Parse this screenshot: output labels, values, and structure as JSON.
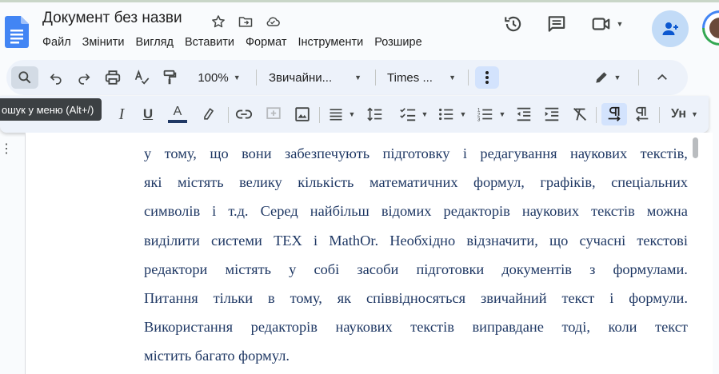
{
  "app": {
    "title": "Документ без назви"
  },
  "menu": [
    "Файл",
    "Змінити",
    "Вигляд",
    "Вставити",
    "Формат",
    "Інструменти",
    "Розшире"
  ],
  "toolbar": {
    "zoom": "100%",
    "style": "Звичайни...",
    "font": "Times ..."
  },
  "tooltip": "ошук у меню (Alt+/)",
  "toolbar2": {
    "styles_label": "Ун"
  },
  "document": {
    "lines": [
      [
        "у",
        "тому,",
        "що",
        "вони",
        "забезпечують",
        "підготовку",
        "і",
        "редагування",
        "наукових",
        "текстів,"
      ],
      [
        "які",
        "містять",
        "велику",
        "кількість",
        "математичних",
        "формул,",
        "графіків,",
        "спеціальних"
      ],
      [
        "символів",
        "і",
        "т.д.",
        " Серед",
        "найбільш",
        "відомих",
        "редакторів",
        "наукових",
        "текстів",
        "можна"
      ],
      [
        "виділити",
        "системи",
        "ТЕХ",
        "і",
        "MathOr.",
        "Необхідно",
        "відзначити,",
        "що",
        "сучасні",
        "текстові"
      ],
      [
        "редактори",
        "містять",
        "у",
        "собі",
        "засоби",
        "підготовки",
        "документів",
        "з",
        "формулами."
      ],
      [
        "Питання",
        "тільки",
        "в",
        "тому,",
        "як",
        "співвідносяться",
        "звичайний",
        "текст",
        "і",
        "формули."
      ],
      [
        "Використання",
        "редакторів",
        "наукових",
        "текстів",
        "виправдане",
        "тоді,",
        "коли",
        "текст"
      ],
      [
        "містить багато формул."
      ]
    ]
  },
  "colors": {
    "text": "#1f3864",
    "toolbar_bg": "#edf2fa",
    "docs_blue": "#4285f4",
    "share_bg": "#c2dbf7"
  }
}
